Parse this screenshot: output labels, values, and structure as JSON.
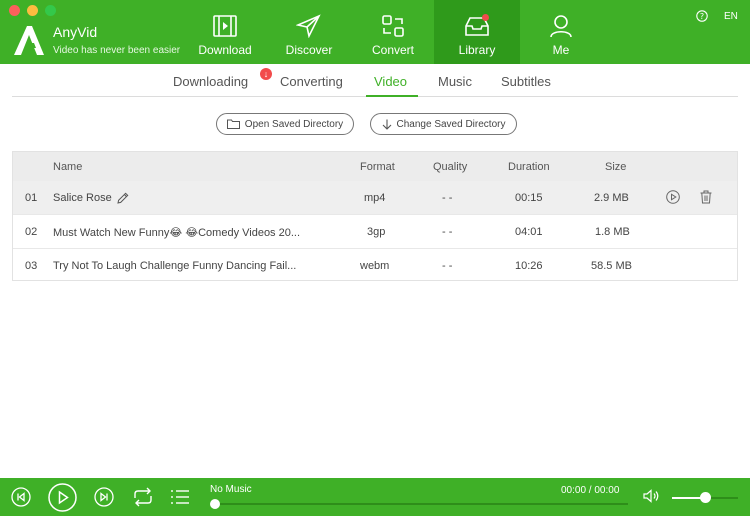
{
  "app": {
    "name": "AnyVid",
    "tagline": "Video has never been easier",
    "language": "EN"
  },
  "nav": [
    {
      "label": "Download",
      "icon": "film-icon"
    },
    {
      "label": "Discover",
      "icon": "paper-plane-icon"
    },
    {
      "label": "Convert",
      "icon": "convert-icon"
    },
    {
      "label": "Library",
      "icon": "inbox-icon",
      "active": true
    },
    {
      "label": "Me",
      "icon": "user-icon"
    }
  ],
  "tabs": [
    {
      "label": "Downloading",
      "badge": "↓"
    },
    {
      "label": "Converting"
    },
    {
      "label": "Video",
      "active": true
    },
    {
      "label": "Music"
    },
    {
      "label": "Subtitles"
    }
  ],
  "buttons": {
    "open_dir": "Open Saved Directory",
    "change_dir": "Change Saved Directory"
  },
  "table": {
    "columns": [
      "Name",
      "Format",
      "Quality",
      "Duration",
      "Size"
    ],
    "rows": [
      {
        "num": "01",
        "name": "Salice Rose",
        "format": "mp4",
        "quality": "- -",
        "duration": "00:15",
        "size": "2.9 MB"
      },
      {
        "num": "02",
        "name": "Must Watch New Funny😂 😂Comedy Videos 20...",
        "format": "3gp",
        "quality": "- -",
        "duration": "04:01",
        "size": "1.8 MB"
      },
      {
        "num": "03",
        "name": "Try Not To Laugh Challenge Funny Dancing Fail...",
        "format": "webm",
        "quality": "- -",
        "duration": "10:26",
        "size": "58.5 MB"
      }
    ]
  },
  "player": {
    "track": "No Music",
    "time": "00:00 / 00:00",
    "progress": 0,
    "volume": 0.45
  },
  "colors": {
    "brand_green": "#3fb027",
    "active_nav": "#2f9a1b",
    "badge_red": "#f24b4b"
  }
}
